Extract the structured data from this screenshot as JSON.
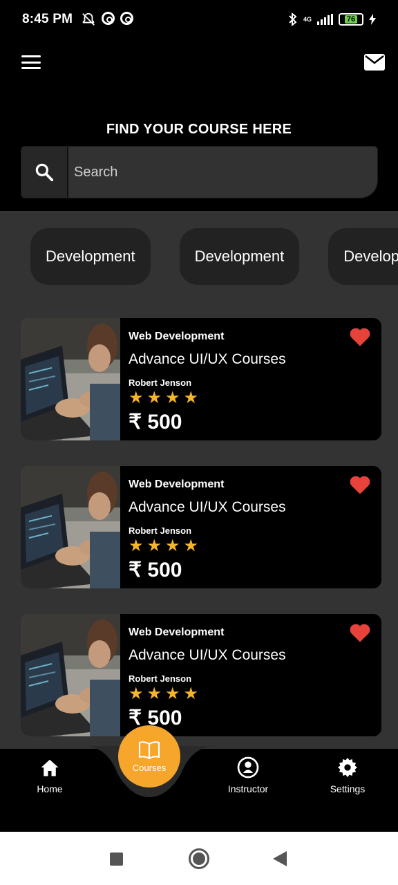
{
  "status_bar": {
    "time": "8:45 PM",
    "network": "4G",
    "battery": "76"
  },
  "header": {
    "title": "FIND YOUR COURSE HERE"
  },
  "search": {
    "placeholder": "Search"
  },
  "categories": [
    "Development",
    "Development",
    "Development"
  ],
  "courses": [
    {
      "category": "Web Development",
      "title": "Advance UI/UX Courses",
      "instructor": "Robert Jenson",
      "rating": 4,
      "stars": "★★★★",
      "price": "₹ 500"
    },
    {
      "category": "Web Development",
      "title": "Advance UI/UX Courses",
      "instructor": "Robert Jenson",
      "rating": 4,
      "stars": "★★★★",
      "price": "₹ 500"
    },
    {
      "category": "Web Development",
      "title": "Advance UI/UX Courses",
      "instructor": "Robert Jenson",
      "rating": 4,
      "stars": "★★★★",
      "price": "₹ 500"
    }
  ],
  "bottom_nav": {
    "home": "Home",
    "courses": "Courses",
    "instructor": "Instructor",
    "settings": "Settings"
  },
  "colors": {
    "accent": "#f5a62b",
    "heart": "#e8433a",
    "star": "#f5b52b",
    "background": "#333333"
  },
  "icons": [
    "menu-icon",
    "mail-icon",
    "search-icon",
    "heart-icon",
    "home-icon",
    "book-icon",
    "user-icon",
    "gear-icon"
  ]
}
